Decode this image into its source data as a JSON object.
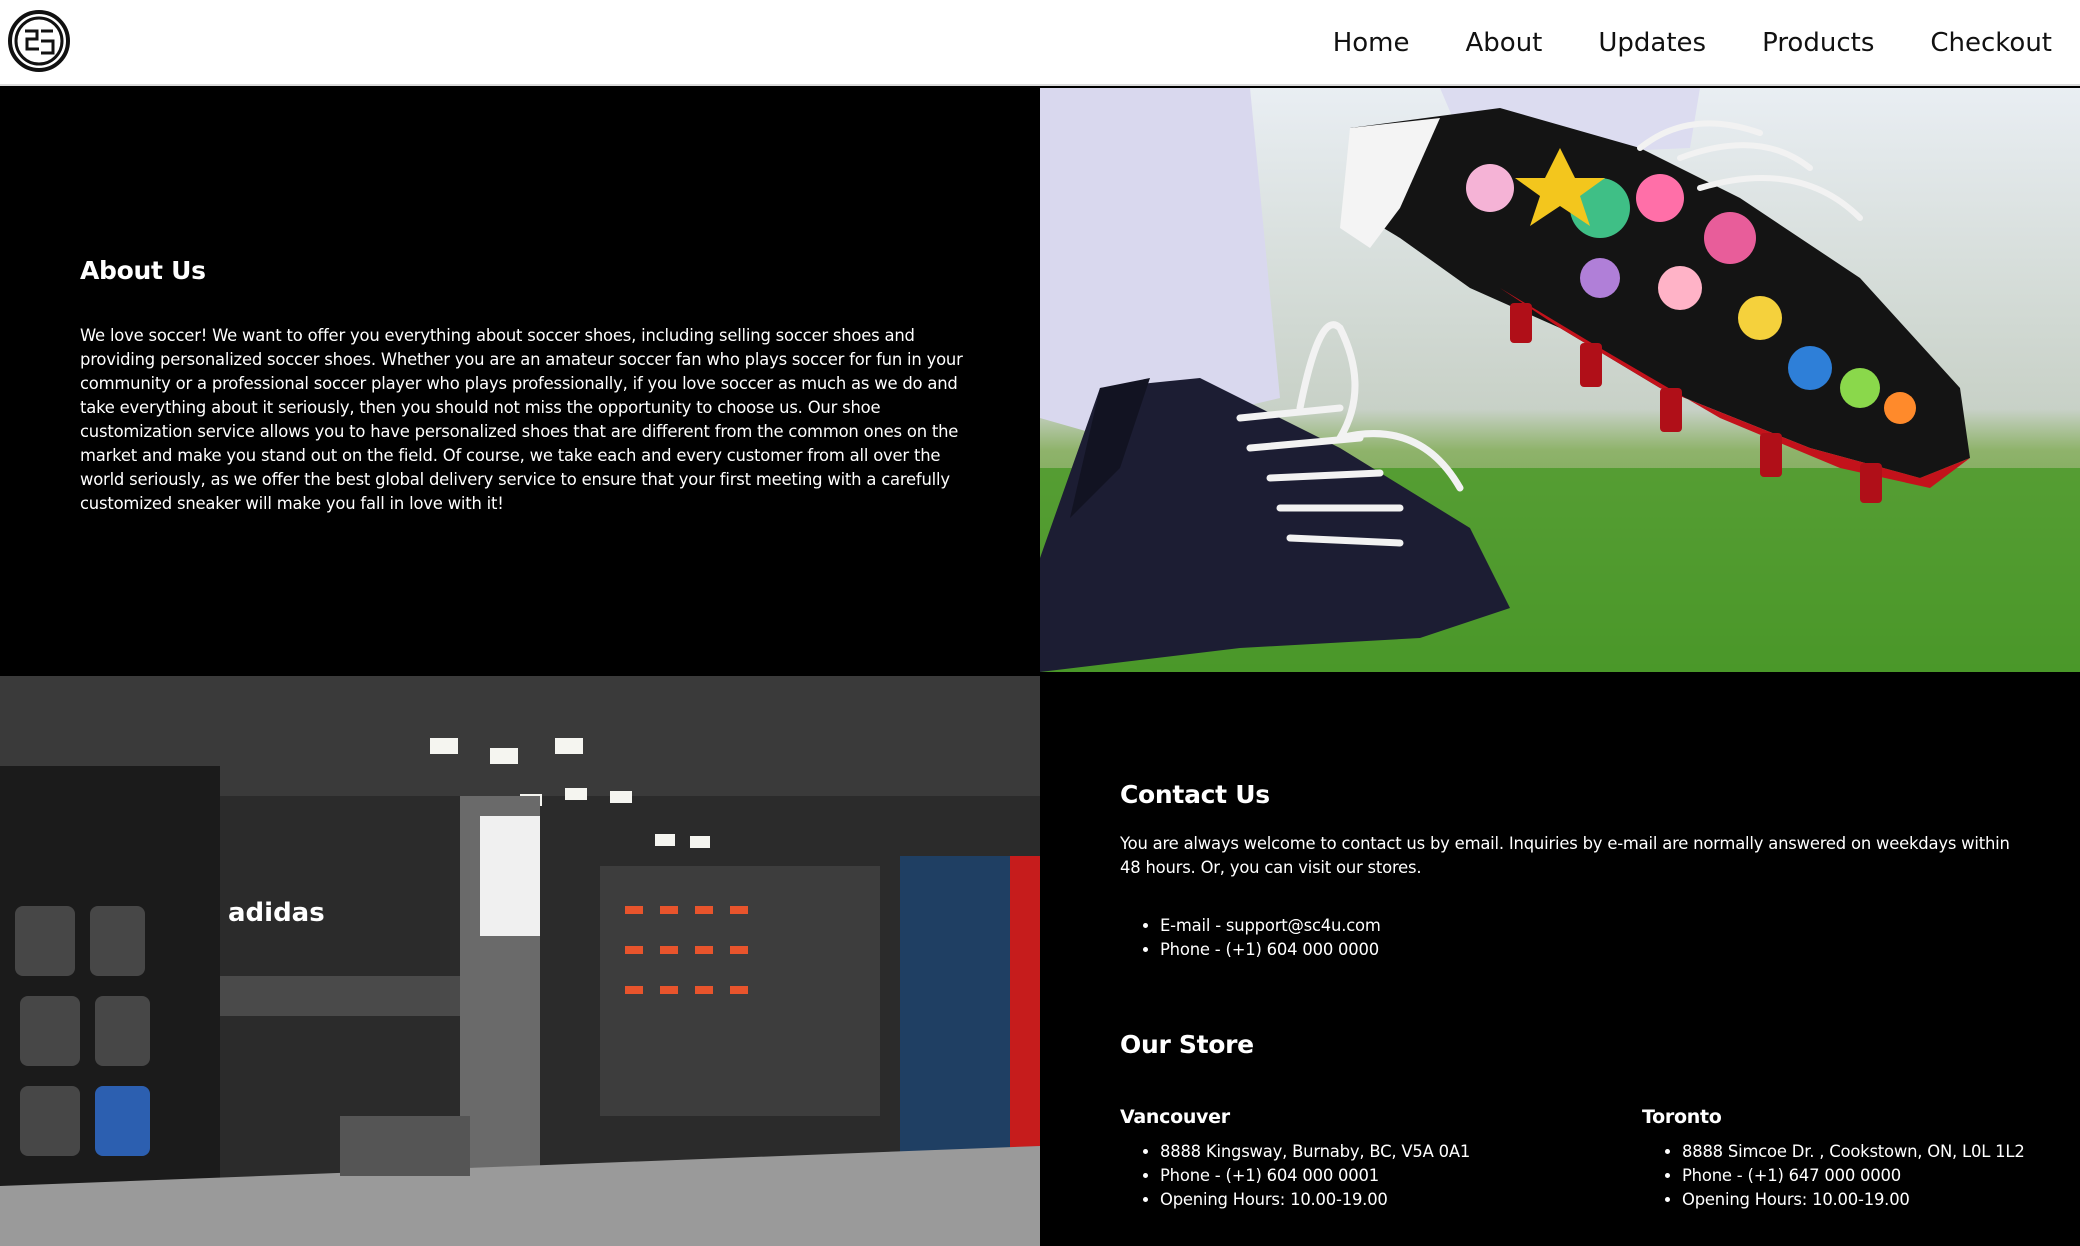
{
  "header": {
    "logo_alt": "SC4U logo",
    "nav": [
      "Home",
      "About",
      "Updates",
      "Products",
      "Checkout"
    ]
  },
  "about": {
    "title": "About Us",
    "body": "We love soccer! We want to offer you everything about soccer shoes, including selling soccer shoes and providing personalized soccer shoes. Whether you are an amateur soccer fan who plays soccer for fun in your community or a professional soccer player who plays professionally, if you love soccer as much as we do and take everything about it seriously, then you should not miss the opportunity to choose us. Our shoe customization service allows you to have personalized shoes that are different from the common ones on the market and make you stand out on the field. Of course, we take each and every customer from all over the world seriously, as we offer the best global delivery service to ensure that your first meeting with a carefully customized sneaker will make you fall in love with it!"
  },
  "contact": {
    "title": "Contact Us",
    "intro": "You are always welcome to contact us by email. Inquiries by e-mail are normally answered on weekdays within 48 hours. Or, you can visit our stores.",
    "items": [
      "E-mail - support@sc4u.com",
      "Phone - (+1) 604 000 0000"
    ]
  },
  "store": {
    "title": "Our Store",
    "locations": [
      {
        "city": "Vancouver",
        "address": "8888 Kingsway, Burnaby, BC, V5A 0A1",
        "phone": "Phone - (+1) 604 000 0001",
        "hours": "Opening Hours: 10.00-19.00"
      },
      {
        "city": "Toronto",
        "address": "8888 Simcoe Dr. , Cookstown, ON, L0L 1L2",
        "phone": "Phone - (+1) 647 000 0000",
        "hours": "Opening Hours: 10.00-19.00"
      }
    ]
  },
  "images": {
    "boot": "custom painted soccer cleat photo",
    "store": "sports store interior photo",
    "store_sign": "adidas"
  }
}
